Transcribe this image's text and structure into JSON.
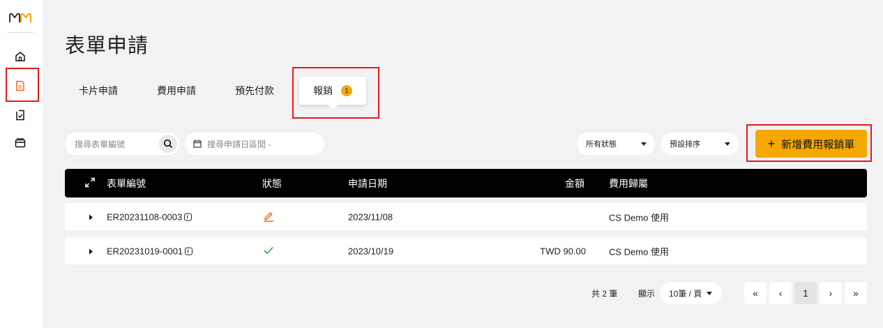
{
  "sidebar": {
    "logo": "logo-icon",
    "items": [
      {
        "name": "home-icon"
      },
      {
        "name": "document-icon",
        "active": true
      },
      {
        "name": "document-check-icon"
      },
      {
        "name": "card-icon"
      }
    ]
  },
  "page": {
    "title": "表單申請"
  },
  "tabs": [
    {
      "label": "卡片申請"
    },
    {
      "label": "費用申請"
    },
    {
      "label": "預先付款"
    },
    {
      "label": "報銷",
      "badge": "1",
      "active": true
    }
  ],
  "filters": {
    "search_placeholder": "搜尋表單編號",
    "date_placeholder": "搜尋申請日區間 -",
    "status_select": "所有狀態",
    "sort_select": "預設排序",
    "add_button": "新增費用報銷單"
  },
  "table": {
    "headers": [
      "表單編號",
      "狀態",
      "申請日期",
      "金額",
      "費用歸屬"
    ],
    "rows": [
      {
        "id": "ER20231108-0003",
        "status": "edit-icon",
        "date": "2023/11/08",
        "amount": "",
        "owner": "CS Demo 使用"
      },
      {
        "id": "ER20231019-0001",
        "status": "check-icon",
        "date": "2023/10/19",
        "amount": "TWD 90.00",
        "owner": "CS Demo 使用"
      }
    ]
  },
  "pagination": {
    "total": "共 2 筆",
    "show_label": "顯示",
    "per_page": "10筆 / 頁",
    "current_page": "1",
    "buttons": [
      "«",
      "‹",
      "›",
      "»"
    ]
  },
  "colors": {
    "accent": "#f7a800",
    "highlight_box": "#e31919",
    "edit": "#f06a1f",
    "check": "#27a745"
  }
}
